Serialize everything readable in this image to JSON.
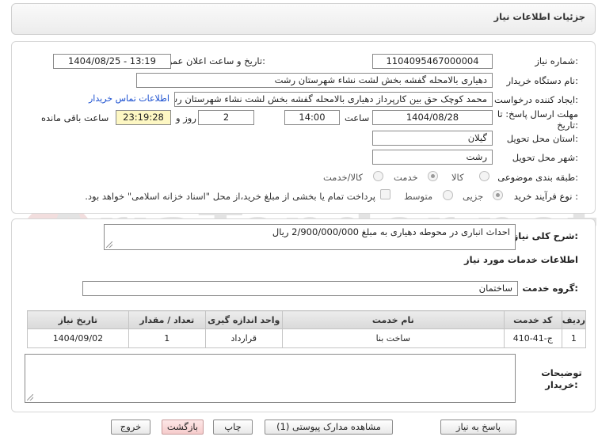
{
  "header": {
    "title": "جزئیات اطلاعات نیاز"
  },
  "form": {
    "need_number": {
      "label": "شماره نیاز:",
      "value": "1104095467000004"
    },
    "announce": {
      "label": "تاریخ و ساعت اعلان عمومی:",
      "value": "1404/08/25 - 13:19"
    },
    "buyer_org": {
      "label": "نام دستگاه خریدار:",
      "value": "دهیاری بالامحله گفشه بخش لشت نشاء شهرستان رشت"
    },
    "requester": {
      "label": "ایجاد کننده درخواست:",
      "value": "محمد کوچک حق بین کارپرداز دهیاری بالامحله گفشه بخش لشت نشاء شهرستان رشت"
    },
    "contact_link": "اطلاعات تماس خریدار",
    "deadline": {
      "label": "مهلت ارسال پاسخ: تا تاریخ:",
      "date": "1404/08/28",
      "time_label": "ساعت",
      "time": "14:00",
      "days": "2",
      "days_label": "روز و",
      "remaining": "23:19:28",
      "remaining_label": "ساعت باقی مانده"
    },
    "province": {
      "label": "استان محل تحویل:",
      "value": "گیلان"
    },
    "city": {
      "label": "شهر محل تحویل:",
      "value": "رشت"
    },
    "category": {
      "label": "طبقه بندی موضوعی:",
      "options": [
        "کالا",
        "خدمت",
        "کالا/خدمت"
      ],
      "selected": "خدمت"
    },
    "purchase_type": {
      "label": "نوع فرآیند خرید :",
      "options": [
        "جزیی",
        "متوسط"
      ],
      "selected": "جزیی",
      "payment_note": "پرداخت تمام یا بخشی از مبلغ خرید،از محل \"اسناد خزانه اسلامی\" خواهد بود."
    }
  },
  "description": {
    "summary_label": "شرح کلی نیاز:",
    "summary_value": "احداث انباری در محوطه دهیاری به مبلغ 2/900/000/000 ریال",
    "services_heading": "اطلاعات خدمات مورد نیاز",
    "service_group_label": "گروه خدمت:",
    "service_group_value": "ساختمان",
    "table": {
      "headers": [
        "ردیف",
        "کد خدمت",
        "نام خدمت",
        "واحد اندازه گیری",
        "تعداد / مقدار",
        "تاریخ نیاز"
      ],
      "rows": [
        [
          "1",
          "ج-41-410",
          "ساخت بنا",
          "قرارداد",
          "1",
          "1404/09/02"
        ]
      ]
    },
    "buyer_notes_label": "توضیحات خریدار:",
    "buyer_notes_value": ""
  },
  "buttons": {
    "reply": "پاسخ به نیاز",
    "attachments": "مشاهده مدارک پیوستی (1)",
    "print": "چاپ",
    "back": "بازگشت",
    "exit": "خروج"
  },
  "watermark": {
    "text": "AriaTender.net"
  },
  "colors": {
    "link": "#1a4fd0",
    "remaining_bg": "#fdf7c3",
    "pink_button": "#f6cccc"
  }
}
